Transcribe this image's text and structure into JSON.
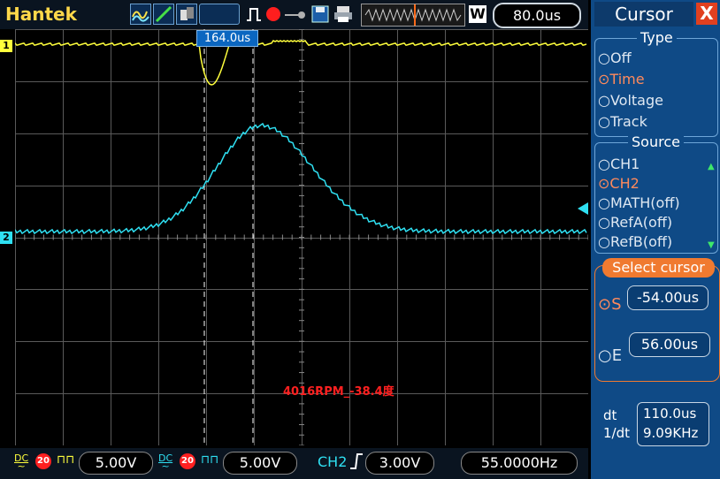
{
  "header": {
    "brand": "Hantek",
    "timebase": "80.0us",
    "trigger_mode_label": "W",
    "icons": [
      "waveform-icon",
      "ramp-icon",
      "color-icon",
      "trigger-edge-icon",
      "run-stop-icon",
      "arrow-icon",
      "save-icon",
      "print-icon"
    ]
  },
  "cursor_readout": "164.0us",
  "measurement_label": "4016RPM_-38.4度",
  "channel_markers": {
    "ch1": "1",
    "ch2": "2"
  },
  "panel": {
    "title": "Cursor",
    "close": "X",
    "type_group": {
      "title": "Type",
      "options": [
        {
          "label": "Off",
          "selected": false
        },
        {
          "label": "Time",
          "selected": true
        },
        {
          "label": "Voltage",
          "selected": false
        },
        {
          "label": "Track",
          "selected": false
        }
      ]
    },
    "source_group": {
      "title": "Source",
      "options": [
        {
          "label": "CH1",
          "selected": false
        },
        {
          "label": "CH2",
          "selected": true
        },
        {
          "label": "MATH(off)",
          "selected": false
        },
        {
          "label": "RefA(off)",
          "selected": false
        },
        {
          "label": "RefB(off)",
          "selected": false
        }
      ]
    },
    "select_cursor": {
      "title": "Select cursor",
      "s_label": "S",
      "s_value": "-54.00us",
      "e_label": "E",
      "e_value": "56.00us"
    },
    "dt_label": "dt",
    "dt_value": "110.0us",
    "inv_dt_label": "1/dt",
    "inv_dt_value": "9.09KHz"
  },
  "footer": {
    "ch1_coupling": "DC",
    "ch1_bw": "20",
    "ch1_volts": "5.00V",
    "ch2_coupling": "DC",
    "ch2_bw": "20",
    "ch2_volts": "5.00V",
    "trigger_source": "CH2",
    "trigger_level": "3.00V",
    "frequency": "55.0000Hz"
  },
  "colors": {
    "ch1": "#ffff3c",
    "ch2": "#2fe0f2",
    "panel_bg": "#0f4a86",
    "accent": "#f07a30",
    "selected_option": "#ff8a5c"
  }
}
